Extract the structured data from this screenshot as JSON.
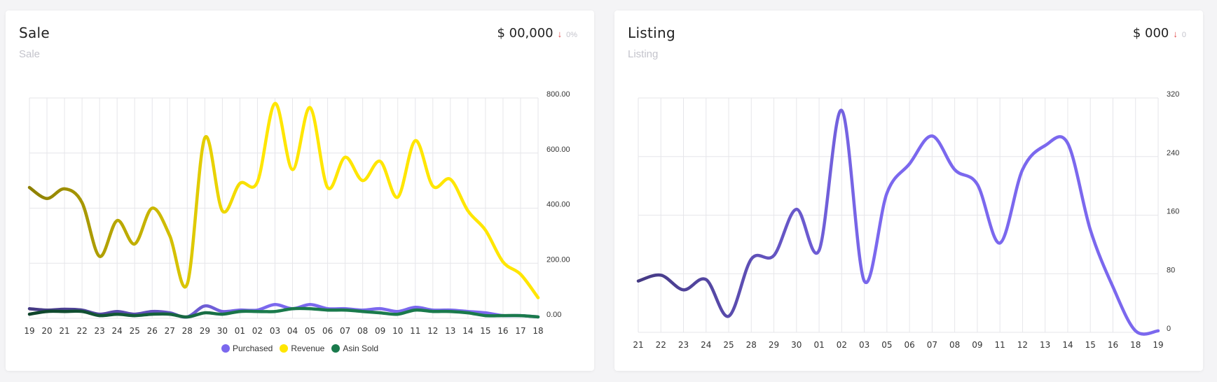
{
  "colors": {
    "purchased": "#7b68ee",
    "revenue": "#ffe600",
    "asin_sold": "#1a7a4c",
    "listing": "#7b68ee",
    "grid": "#e6e6ea",
    "down": "#e24a4a"
  },
  "sale_card": {
    "title": "Sale",
    "subtitle": "Sale",
    "stat_value": "$ 00,000",
    "stat_arrow_icon": "arrow-down-icon",
    "stat_change": "0%"
  },
  "listing_card": {
    "title": "Listing",
    "subtitle": "Listing",
    "stat_value": "$ 000",
    "stat_arrow_icon": "arrow-down-icon",
    "stat_change": "0"
  },
  "chart_data": [
    {
      "type": "line",
      "categories": [
        "19",
        "20",
        "21",
        "22",
        "23",
        "24",
        "25",
        "26",
        "27",
        "28",
        "29",
        "30",
        "01",
        "02",
        "03",
        "04",
        "05",
        "06",
        "07",
        "08",
        "09",
        "10",
        "11",
        "12",
        "13",
        "14",
        "15",
        "16",
        "17",
        "18"
      ],
      "ylim": [
        0,
        800
      ],
      "yticks": [
        "0.00",
        "200.00",
        "400.00",
        "600.00",
        "800.00"
      ],
      "y_axis_position": "right",
      "grid": true,
      "legend_position": "bottom",
      "series": [
        {
          "name": "Purchased",
          "values": [
            35,
            30,
            33,
            30,
            15,
            25,
            15,
            25,
            20,
            5,
            45,
            25,
            30,
            30,
            50,
            35,
            50,
            35,
            35,
            30,
            35,
            25,
            40,
            30,
            30,
            25,
            20,
            10,
            10,
            5
          ]
        },
        {
          "name": "Revenue",
          "values": [
            475,
            435,
            470,
            420,
            225,
            355,
            270,
            400,
            300,
            125,
            655,
            390,
            490,
            495,
            780,
            540,
            765,
            475,
            585,
            500,
            570,
            440,
            645,
            480,
            505,
            390,
            320,
            205,
            160,
            75
          ]
        },
        {
          "name": "Asin Sold",
          "values": [
            15,
            25,
            25,
            25,
            10,
            15,
            10,
            15,
            15,
            5,
            20,
            15,
            25,
            25,
            25,
            35,
            35,
            30,
            30,
            25,
            20,
            15,
            30,
            25,
            25,
            20,
            10,
            10,
            10,
            5
          ]
        }
      ]
    },
    {
      "type": "line",
      "categories": [
        "21",
        "22",
        "23",
        "24",
        "25",
        "28",
        "29",
        "30",
        "01",
        "02",
        "03",
        "05",
        "06",
        "07",
        "08",
        "09",
        "11",
        "12",
        "13",
        "14",
        "15",
        "16",
        "18",
        "19"
      ],
      "ylim": [
        0,
        320
      ],
      "yticks": [
        "0",
        "80",
        "160",
        "240",
        "320"
      ],
      "y_axis_position": "right",
      "grid": true,
      "series": [
        {
          "values": [
            70,
            78,
            58,
            72,
            22,
            100,
            105,
            168,
            112,
            303,
            70,
            190,
            230,
            268,
            222,
            202,
            122,
            222,
            255,
            258,
            140,
            62,
            2,
            2
          ]
        }
      ]
    }
  ]
}
